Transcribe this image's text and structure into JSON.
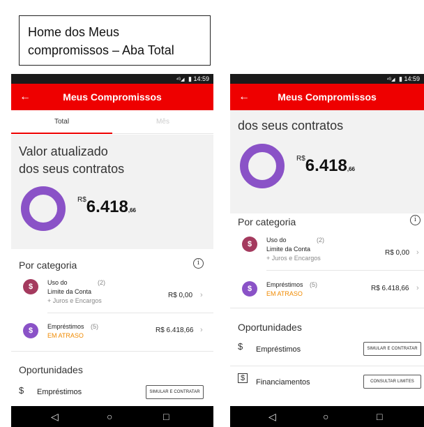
{
  "caption": {
    "line1": "Home dos Meus",
    "line2": "compromissos – Aba Total"
  },
  "status": {
    "time": "14:59",
    "signal": "⁴ᴳ◢",
    "battery": "▮"
  },
  "app": {
    "back_icon": "←",
    "title": "Meus Compromissos"
  },
  "tabs": {
    "total": "Total",
    "mes": "Mês"
  },
  "valor": {
    "line1": "Valor atualizado",
    "line2": "dos seus contratos",
    "currency": "R$",
    "amount": "6.418",
    "cents": ",66"
  },
  "categoria": {
    "heading": "Por categoria",
    "info_icon": "i",
    "items": [
      {
        "icon": "$",
        "line1": "Uso do",
        "count": "(2)",
        "line2": "Limite da Conta",
        "sub": "+ Juros e Encargos",
        "value": "R$ 0,00"
      },
      {
        "icon": "$",
        "line1": "Empréstimos",
        "count": "(5)",
        "sub": "EM ATRASO",
        "value": "R$ 6.418,66"
      }
    ]
  },
  "oportunidades": {
    "heading": "Oportunidades",
    "items": [
      {
        "label": "Empréstimos",
        "button": "SIMULAR E CONTRATAR"
      },
      {
        "label": "Financiamentos",
        "button": "CONSULTAR LIMITES"
      }
    ]
  },
  "chevron": "›",
  "nav": {
    "back": "◁",
    "home": "○",
    "recent": "□"
  },
  "colors": {
    "brand_red": "#ee0000",
    "ring_purple": "#8a52c7",
    "late_orange": "#f08a00"
  }
}
